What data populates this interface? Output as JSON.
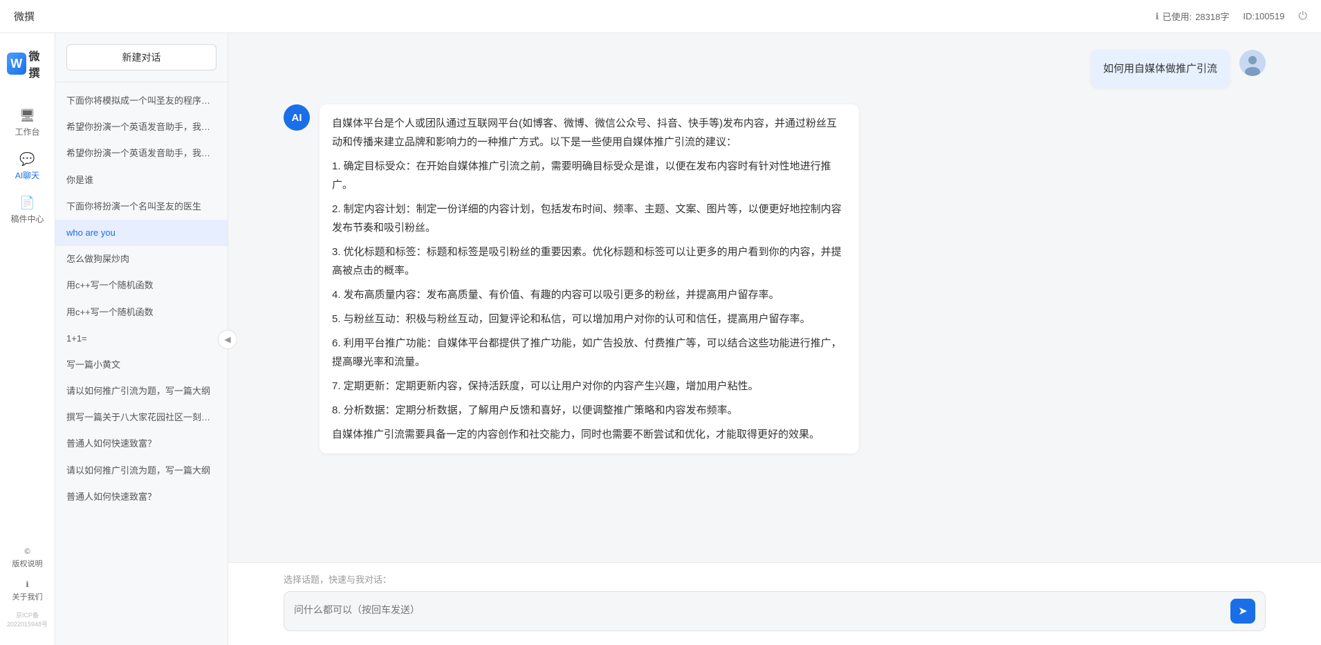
{
  "topbar": {
    "title": "微撰",
    "usage_label": "已使用:",
    "usage_value": "28318字",
    "id_label": "ID:100519",
    "logout_icon": "⏻"
  },
  "logo": {
    "w": "W",
    "text": "微撰"
  },
  "nav": {
    "items": [
      {
        "id": "workspace",
        "label": "工作台",
        "icon": "🖥"
      },
      {
        "id": "ai-chat",
        "label": "AI聊天",
        "icon": "💬",
        "active": true
      },
      {
        "id": "drafts",
        "label": "稿件中心",
        "icon": "📄"
      }
    ],
    "bottom_items": [
      {
        "id": "copyright",
        "label": "版权说明",
        "icon": "©"
      },
      {
        "id": "about",
        "label": "关于我们",
        "icon": "ℹ"
      }
    ],
    "icp": "京ICP备2022015948号"
  },
  "sidebar": {
    "new_chat_label": "新建对话",
    "conversations": [
      {
        "id": 1,
        "text": "下面你将模拟成一个叫圣友的程序员，我说...",
        "active": false
      },
      {
        "id": 2,
        "text": "希望你扮演一个英语发音助手，我提供给你...",
        "active": false
      },
      {
        "id": 3,
        "text": "希望你扮演一个英语发音助手，我提供给你...",
        "active": false
      },
      {
        "id": 4,
        "text": "你是谁",
        "active": false
      },
      {
        "id": 5,
        "text": "下面你将扮演一个名叫圣友的医生",
        "active": false
      },
      {
        "id": 6,
        "text": "who are you",
        "active": true
      },
      {
        "id": 7,
        "text": "怎么做狗屎炒肉",
        "active": false
      },
      {
        "id": 8,
        "text": "用c++写一个随机函数",
        "active": false
      },
      {
        "id": 9,
        "text": "用c++写一个随机函数",
        "active": false
      },
      {
        "id": 10,
        "text": "1+1=",
        "active": false
      },
      {
        "id": 11,
        "text": "写一篇小黄文",
        "active": false
      },
      {
        "id": 12,
        "text": "请以如何推广引流为题，写一篇大纲",
        "active": false
      },
      {
        "id": 13,
        "text": "撰写一篇关于八大家花园社区一刻钟便民生...",
        "active": false
      },
      {
        "id": 14,
        "text": "普通人如何快速致富？",
        "active": false
      },
      {
        "id": 15,
        "text": "请以如何推广引流为题，写一篇大纲",
        "active": false
      },
      {
        "id": 16,
        "text": "普通人如何快速致富？",
        "active": false
      }
    ]
  },
  "chat": {
    "user_question": "如何用自媒体做推广引流",
    "ai_response_paragraphs": [
      "自媒体平台是个人或团队通过互联网平台(如博客、微博、微信公众号、抖音、快手等)发布内容，并通过粉丝互动和传播来建立品牌和影响力的一种推广方式。以下是一些使用自媒体推广引流的建议：",
      "1. 确定目标受众：在开始自媒体推广引流之前，需要明确目标受众是谁，以便在发布内容时有针对性地进行推广。",
      "2. 制定内容计划：制定一份详细的内容计划，包括发布时间、频率、主题、文案、图片等，以便更好地控制内容发布节奏和吸引粉丝。",
      "3. 优化标题和标签：标题和标签是吸引粉丝的重要因素。优化标题和标签可以让更多的用户看到你的内容，并提高被点击的概率。",
      "4. 发布高质量内容：发布高质量、有价值、有趣的内容可以吸引更多的粉丝，并提高用户留存率。",
      "5. 与粉丝互动：积极与粉丝互动，回复评论和私信，可以增加用户对你的认可和信任，提高用户留存率。",
      "6. 利用平台推广功能：自媒体平台都提供了推广功能，如广告投放、付费推广等，可以结合这些功能进行推广，提高曝光率和流量。",
      "7. 定期更新：定期更新内容，保持活跃度，可以让用户对你的内容产生兴趣，增加用户粘性。",
      "8. 分析数据：定期分析数据，了解用户反馈和喜好，以便调整推广策略和内容发布频率。",
      "自媒体推广引流需要具备一定的内容创作和社交能力，同时也需要不断尝试和优化，才能取得更好的效果。"
    ],
    "input_placeholder": "问什么都可以（按回车发送）",
    "quick_topics_label": "选择话题，快速与我对话："
  }
}
